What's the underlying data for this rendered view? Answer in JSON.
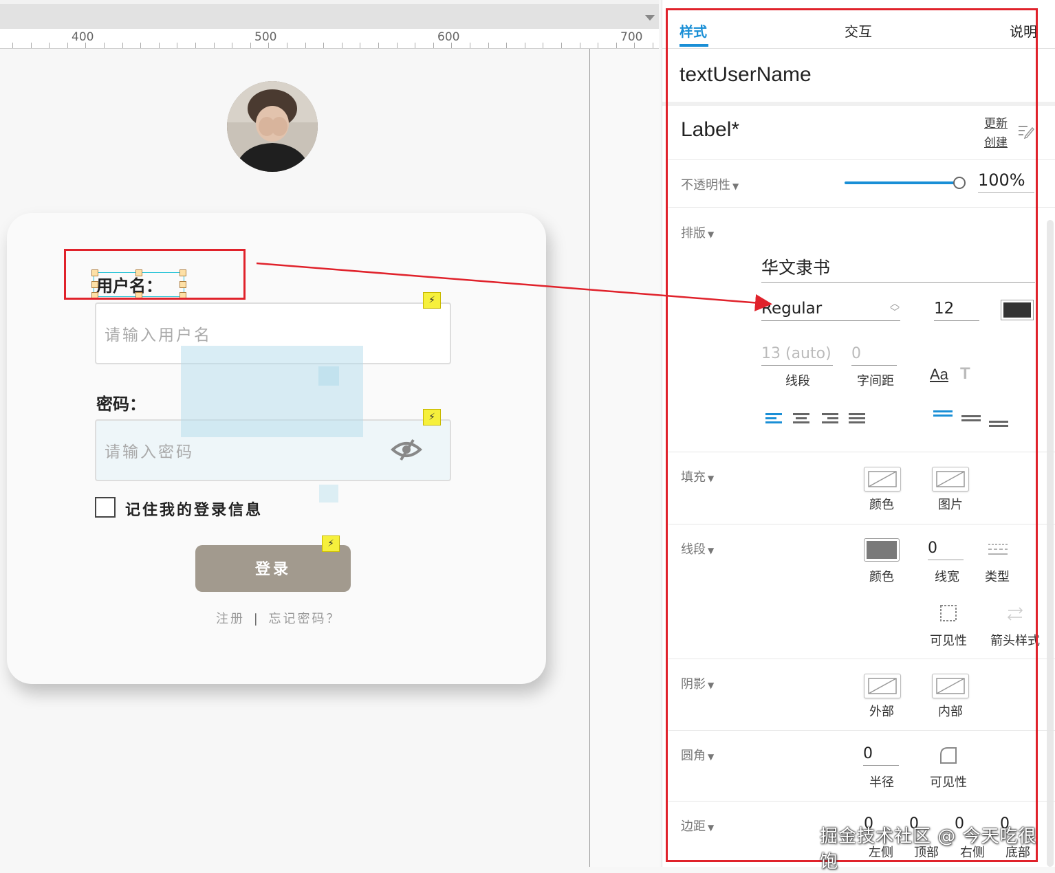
{
  "ruler": {
    "labels": [
      "400",
      "500",
      "600",
      "700"
    ]
  },
  "canvas": {
    "username_label": "用户名：",
    "username_placeholder": "请输入用户名",
    "password_label": "密码：",
    "password_placeholder": "请输入密码",
    "remember_label": "记住我的登录信息",
    "login_button": "登录",
    "register_link": "注册",
    "separator": "|",
    "forgot_link": "忘记密码？",
    "bolt_glyph": "⚡"
  },
  "panel": {
    "tabs": [
      "样式",
      "交互",
      "说明"
    ],
    "widget_name": "textUserName",
    "style_name": "Label*",
    "update_link": "更新",
    "create_link": "创建",
    "opacity": {
      "label": "不透明性",
      "value": "100%",
      "level": 1.0
    },
    "typography": {
      "label": "排版",
      "font_family": "华文隶书",
      "font_weight": "Regular",
      "font_size": "12",
      "font_color": "#333333",
      "line_height": "13 (auto)",
      "char_spacing": "0",
      "line_height_caption": "线段",
      "char_spacing_caption": "字间距",
      "aa_icon": "Aa",
      "t_icon": "T"
    },
    "fill": {
      "label": "填充",
      "color_caption": "颜色",
      "image_caption": "图片"
    },
    "stroke": {
      "label": "线段",
      "color_caption": "颜色",
      "color": "#7a7a7a",
      "width": "0",
      "width_caption": "线宽",
      "type_caption": "类型",
      "visibility_caption": "可见性",
      "arrow_caption": "箭头样式"
    },
    "shadow": {
      "label": "阴影",
      "outer_caption": "外部",
      "inner_caption": "内部"
    },
    "corner": {
      "label": "圆角",
      "radius": "0",
      "radius_caption": "半径",
      "visibility_caption": "可见性"
    },
    "padding": {
      "label": "边距",
      "values": [
        "0",
        "0",
        "0",
        "0"
      ],
      "captions": [
        "左侧",
        "顶部",
        "右侧",
        "底部"
      ]
    },
    "accent_color": "#1a8fd6",
    "annotation_color": "#e0222b"
  },
  "watermark": "掘金技术社区 @ 今天吃很饱"
}
